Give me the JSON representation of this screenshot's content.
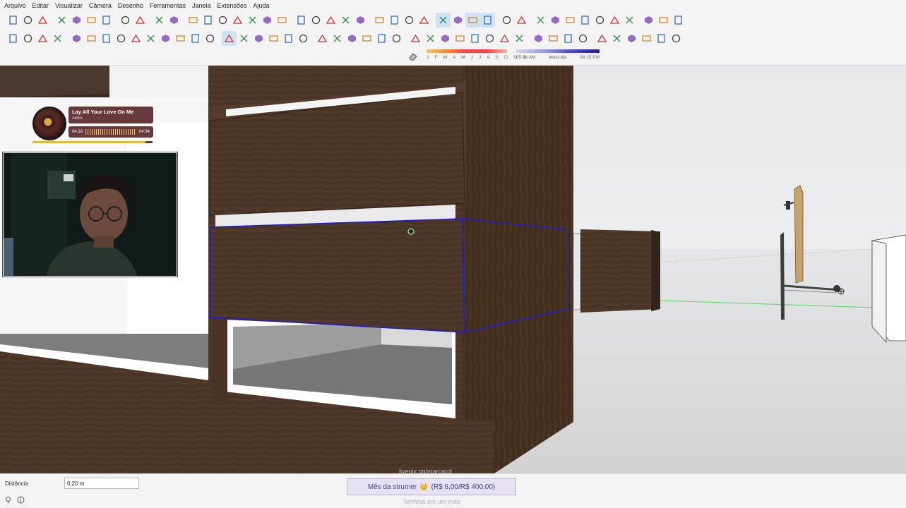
{
  "menu": [
    "Arquivo",
    "Editar",
    "Visualizar",
    "Câmera",
    "Desenho",
    "Ferramentas",
    "Janela",
    "Extensões",
    "Ajuda"
  ],
  "toolbar1_icons": [
    "new-file-icon",
    "open-folder-icon",
    "save-icon",
    "cut-icon",
    "copy-icon",
    "paste-icon",
    "delete-icon",
    "undo-icon",
    "redo-icon",
    "print-icon",
    "model-info-icon",
    "iso-view-icon",
    "top-view-icon",
    "front-view-icon",
    "right-view-icon",
    "back-view-icon",
    "left-view-icon",
    "bottom-view-icon",
    "orbit-icon",
    "pan-icon",
    "zoom-icon",
    "zoom-extents-icon",
    "previous-view-icon",
    "xray-icon",
    "back-edges-icon",
    "wireframe-icon",
    "hidden-line-icon",
    "shaded-icon",
    "textured-icon",
    "monochrome-icon",
    "styles-icon",
    "section-plane-icon",
    "display-section-icon",
    "warehouse-icon",
    "extension-warehouse-icon",
    "layout-icon",
    "extension-manager-icon",
    "cloud-icon",
    "settings-icon",
    "window-icon",
    "info-icon",
    "cart-icon",
    "account-icon"
  ],
  "toolbar2_icons": [
    "select-icon",
    "component-icon",
    "paint-bucket-icon",
    "eraser-icon",
    "pencil-icon",
    "freehand-icon",
    "rectangle-icon",
    "rotated-rectangle-icon",
    "circle-icon",
    "polygon-icon",
    "arc-icon",
    "two-point-arc-icon",
    "three-point-arc-icon",
    "pie-icon",
    "move-icon",
    "push-pull-icon",
    "rotate-icon",
    "follow-me-icon",
    "scale-icon",
    "offset-icon",
    "tape-measure-icon",
    "dimension-icon",
    "protractor-icon",
    "text-icon",
    "axes-icon",
    "3d-text-icon",
    "orbit-icon",
    "pan-icon",
    "zoom-icon",
    "zoom-window-icon",
    "zoom-extents-icon",
    "walk-icon",
    "look-around-icon",
    "position-camera-icon",
    "section-plane-icon",
    "outer-shell-icon",
    "intersect-icon",
    "union-icon",
    "subtract-icon",
    "trim-icon",
    "split-icon",
    "sandbox-icon",
    "stamp-icon",
    "drape-icon"
  ],
  "shadow": {
    "months": "J F M A M J J A S O N D",
    "time_start": "05:36 AM",
    "time_mid": "Meio-dia",
    "time_end": "06:15 PM"
  },
  "music": {
    "song": "Lay All Your Love On Me",
    "artist": "ABBA",
    "elapsed": "04:18",
    "total": "04:34",
    "progress": 0.94
  },
  "status": {
    "distance_label": "Distância",
    "distance_value": "0,20 m",
    "sub_goal": "Mês da strumer",
    "sub_goal_emoji": "👑",
    "sub_goal_progress": "(R$ 6,00/R$ 400,00)",
    "sub_goal_end": "Termina em um mês"
  },
  "watermark": "livepix.gg/marcarol",
  "colors": {
    "wood": "#4e3628",
    "wood_dark": "#3a281d",
    "selection": "#1c1ccf",
    "ui_bg": "#f3f3f3"
  }
}
